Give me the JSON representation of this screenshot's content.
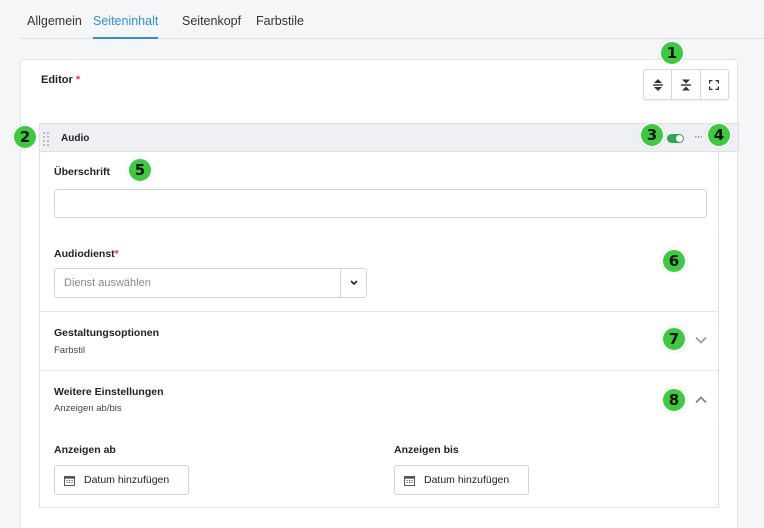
{
  "tabs": [
    {
      "label": "Allgemein"
    },
    {
      "label": "Seiteninhalt",
      "active": true
    },
    {
      "label": "Seitenkopf"
    },
    {
      "label": "Farbstile"
    }
  ],
  "editor": {
    "label": "Editor",
    "required_mark": "*",
    "toolbar": [
      {
        "icon": "expand-vertical-icon"
      },
      {
        "icon": "collapse-vertical-icon"
      },
      {
        "icon": "fullscreen-icon"
      }
    ]
  },
  "block": {
    "title": "Audio",
    "enabled": true,
    "more_label": "···",
    "heading_field": {
      "label": "Überschrift",
      "value": ""
    },
    "service_field": {
      "label": "Audiodienst",
      "required_mark": "*",
      "placeholder": "Dienst auswählen"
    },
    "styling": {
      "title": "Gestaltungsoptionen",
      "subtitle": "Farbstil",
      "expanded": false
    },
    "advanced": {
      "title": "Weitere Einstellungen",
      "subtitle": "Anzeigen ab/bis",
      "expanded": true,
      "show_from": {
        "label": "Anzeigen ab",
        "button": "Datum hinzufügen"
      },
      "show_until": {
        "label": "Anzeigen bis",
        "button": "Datum hinzufügen"
      }
    }
  },
  "annotations": [
    "1",
    "2",
    "3",
    "4",
    "5",
    "6",
    "7",
    "8"
  ],
  "colors": {
    "accent": "#2f8fd8",
    "toggle": "#2fa84f",
    "badge": "#3ccb3f",
    "required": "#e53935"
  }
}
